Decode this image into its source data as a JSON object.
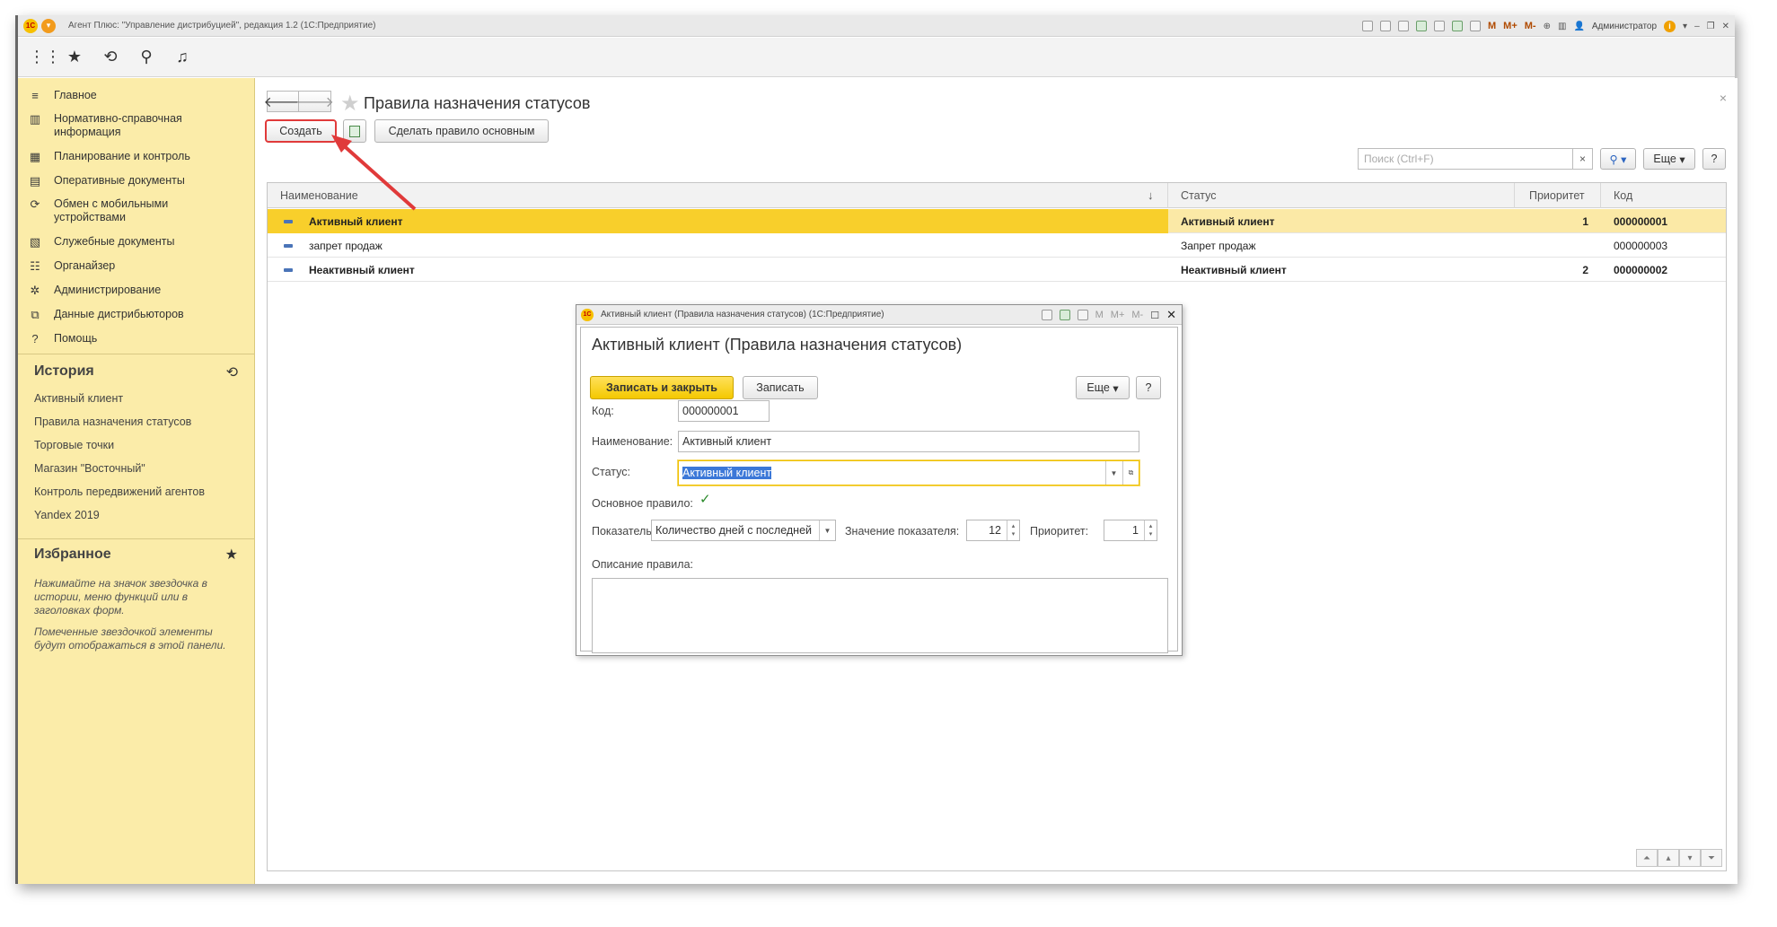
{
  "window": {
    "title": "Агент Плюс: \"Управление дистрибуцией\", редакция 1.2  (1С:Предприятие)",
    "logo": "1С",
    "user": "Администратор",
    "tb_m1": "M",
    "tb_m2": "M+",
    "tb_m3": "M-"
  },
  "toprow_icons": [
    "apps-grid-icon",
    "star-icon",
    "history-icon",
    "search-icon",
    "bell-icon"
  ],
  "sidebar": {
    "items": [
      {
        "label": "Главное",
        "icon": "≡"
      },
      {
        "label": "Нормативно-справочная информация",
        "icon": "▥"
      },
      {
        "label": "Планирование и контроль",
        "icon": "▦"
      },
      {
        "label": "Оперативные документы",
        "icon": "▤"
      },
      {
        "label": "Обмен с мобильными устройствами",
        "icon": "⟳"
      },
      {
        "label": "Служебные документы",
        "icon": "▧"
      },
      {
        "label": "Органайзер",
        "icon": "☷"
      },
      {
        "label": "Администрирование",
        "icon": "✲"
      },
      {
        "label": "Данные дистрибьюторов",
        "icon": "⧉"
      },
      {
        "label": "Помощь",
        "icon": "?"
      }
    ],
    "history_title": "История",
    "history": [
      "Активный клиент",
      "Правила назначения статусов",
      "Торговые точки",
      "Магазин \"Восточный\"",
      "Контроль передвижений агентов",
      "Yandex 2019"
    ],
    "favorites_title": "Избранное",
    "favorites_note1": "Нажимайте на значок звездочка в истории, меню функций или в заголовках форм.",
    "favorites_note2": "Помеченные звездочкой элементы будут отображаться в этой панели."
  },
  "form": {
    "title": "Правила назначения статусов",
    "create": "Создать",
    "make_main": "Сделать правило основным",
    "search_placeholder": "Поиск (Ctrl+F)",
    "more": "Еще",
    "help": "?",
    "columns": {
      "name": "Наименование",
      "status": "Статус",
      "priority": "Приоритет",
      "code": "Код"
    },
    "rows": [
      {
        "name": "Активный клиент",
        "status": "Активный клиент",
        "priority": "1",
        "code": "000000001"
      },
      {
        "name": "запрет продаж",
        "status": "Запрет продаж",
        "priority": "",
        "code": "000000003"
      },
      {
        "name": "Неактивный клиент",
        "status": "Неактивный клиент",
        "priority": "2",
        "code": "000000002"
      }
    ]
  },
  "dialog": {
    "window_title": "Активный клиент (Правила назначения статусов)  (1С:Предприятие)",
    "title": "Активный клиент (Правила назначения статусов)",
    "save_close": "Записать и закрыть",
    "save": "Записать",
    "more": "Еще",
    "help": "?",
    "code_label": "Код:",
    "code_value": "000000001",
    "name_label": "Наименование:",
    "name_value": "Активный клиент",
    "status_label": "Статус:",
    "status_value": "Активный клиент",
    "main_rule_label": "Основное правило:",
    "main_rule_checked": true,
    "indicator_label": "Показатель:",
    "indicator_value": "Количество дней с последней",
    "indicator_value_label": "Значение показателя:",
    "indicator_value_value": "12",
    "priority_label": "Приоритет:",
    "priority_value": "1",
    "description_label": "Описание правила:"
  },
  "colors": {
    "sidebar_bg": "#fbeca9",
    "selected_row": "#fbe9a6",
    "selected_cell": "#f8cf2b",
    "accent_yellow": "#f4c800",
    "annotation_red": "#e03a3a"
  }
}
